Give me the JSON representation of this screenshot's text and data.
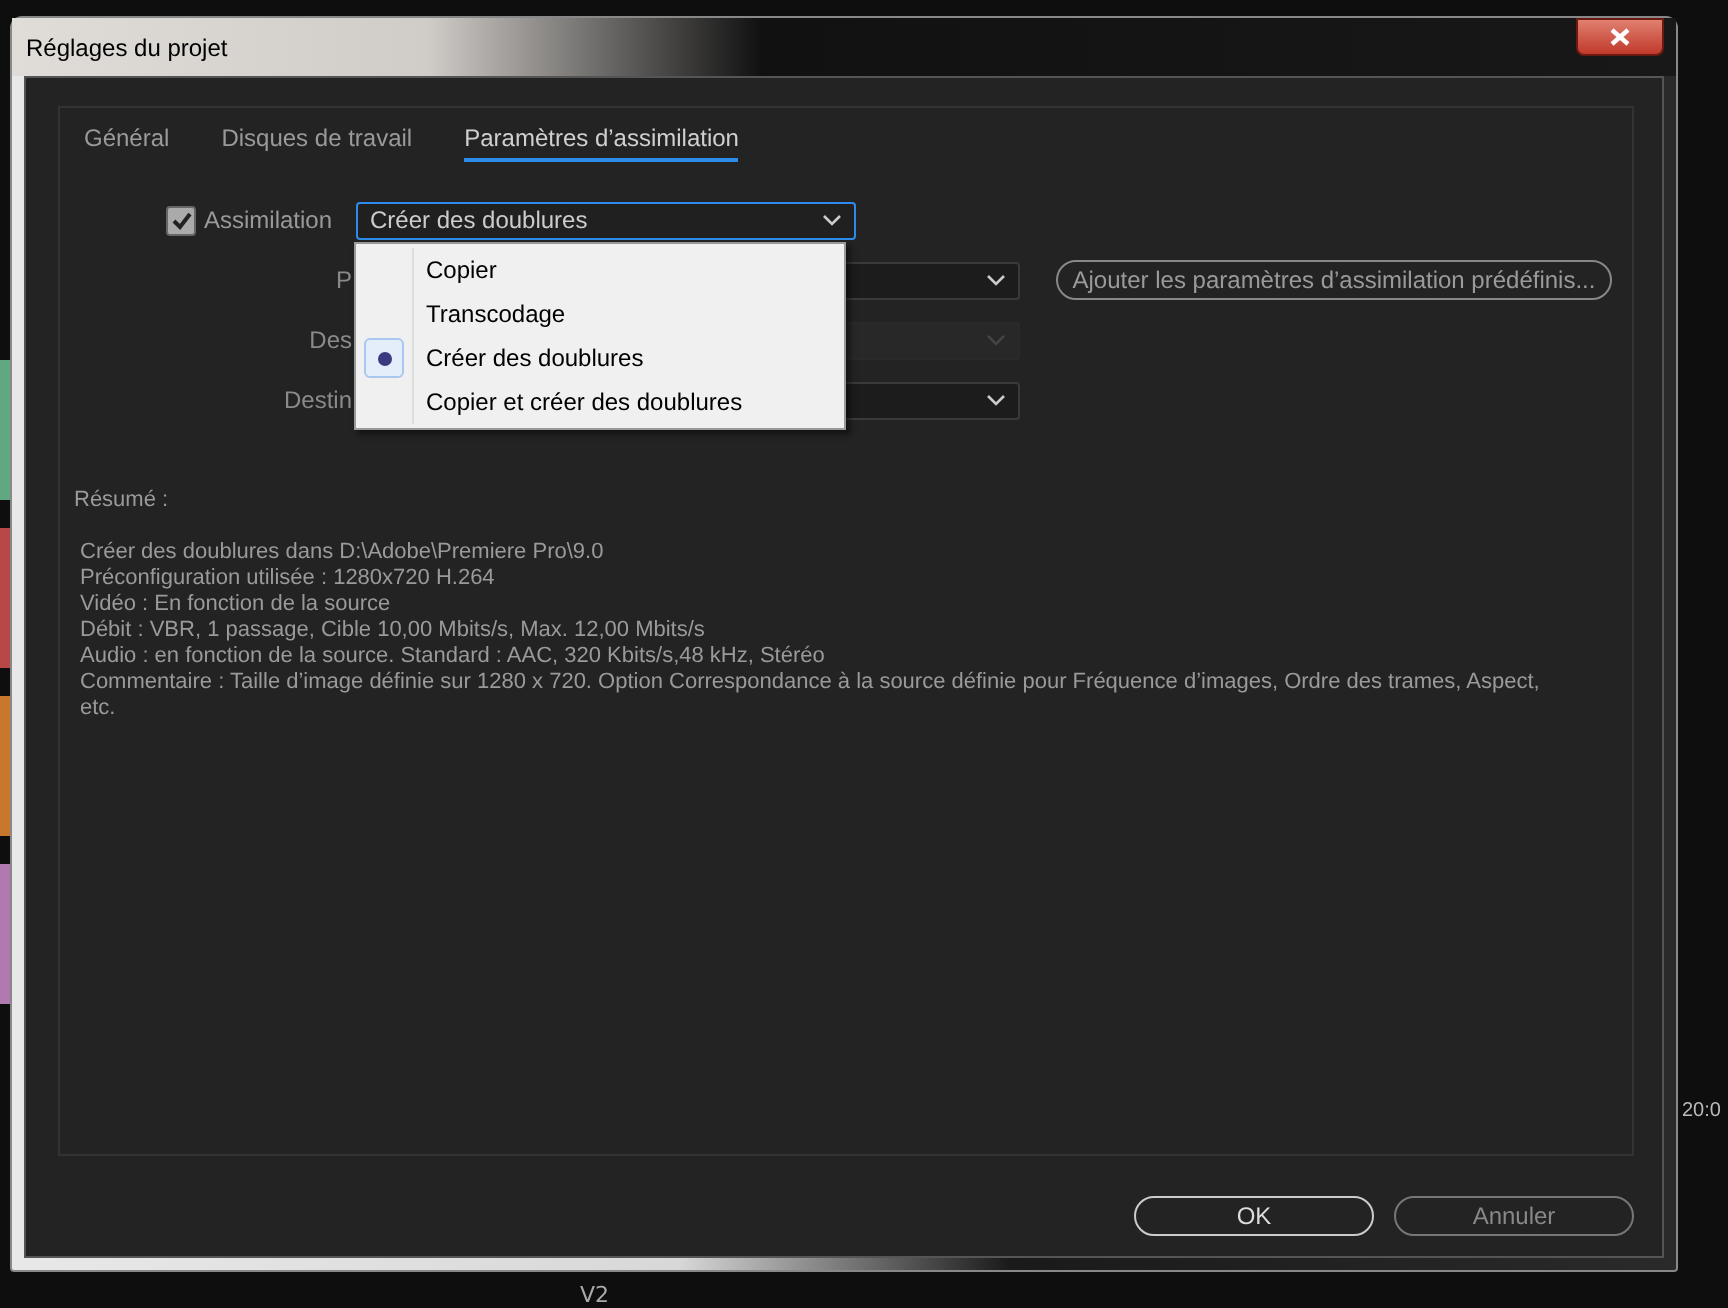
{
  "background_app": {
    "track_label": "V2",
    "timecode": "20:0"
  },
  "window": {
    "title": "Réglages du projet"
  },
  "tabs": [
    {
      "label": "Général",
      "selected": false
    },
    {
      "label": "Disques de travail",
      "selected": false
    },
    {
      "label": "Paramètres d’assimilation",
      "selected": true
    }
  ],
  "ingest": {
    "label": "Assimilation",
    "checked": true,
    "value": "Créer des doublures"
  },
  "rows": [
    {
      "label": "P",
      "disabled": false
    },
    {
      "label": "Des",
      "disabled": true
    },
    {
      "label": "Destin",
      "disabled": false
    }
  ],
  "add_preset_button": "Ajouter les paramètres d’assimilation prédéfinis...",
  "menu": [
    {
      "label": "Copier",
      "selected": false
    },
    {
      "label": "Transcodage",
      "selected": false
    },
    {
      "label": "Créer des doublures",
      "selected": true
    },
    {
      "label": "Copier et créer des doublures",
      "selected": false
    }
  ],
  "summary": {
    "title": "Résumé :",
    "lines": [
      "Créer des doublures dans D:\\Adobe\\Premiere Pro\\9.0",
      "Préconfiguration utilisée : 1280x720 H.264",
      "Vidéo : En fonction de la source",
      "Débit : VBR, 1 passage, Cible 10,00  Mbits/s, Max. 12,00  Mbits/s",
      "Audio : en fonction de la source. Standard  : AAC, 320  Kbits/s,48  kHz, Stéréo",
      "Commentaire : Taille d’image définie sur 1280 x 720. Option Correspondance à la source définie pour Fréquence d’images, Ordre des trames, Aspect, etc."
    ]
  },
  "buttons": [
    {
      "label": "OK",
      "kind": "primary"
    },
    {
      "label": "Annuler",
      "kind": "secondary"
    }
  ]
}
